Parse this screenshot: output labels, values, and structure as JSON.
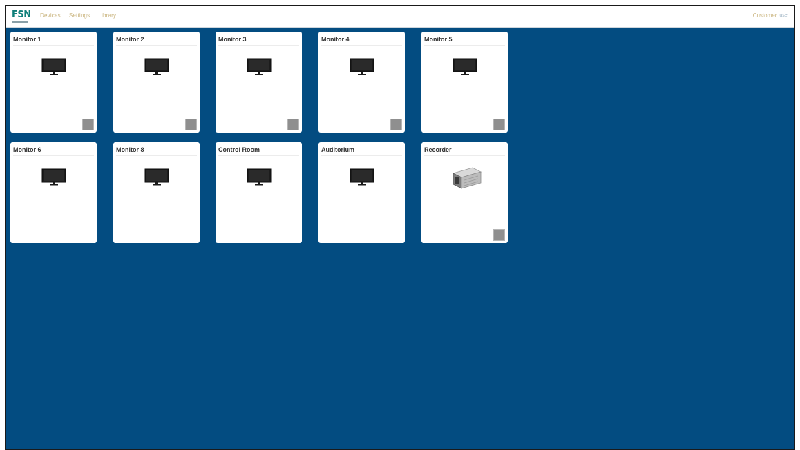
{
  "header": {
    "logo_text": "FSN",
    "nav": [
      {
        "label": "Devices"
      },
      {
        "label": "Settings"
      },
      {
        "label": "Library"
      }
    ],
    "user": {
      "name": "Customer",
      "dropdown": "user"
    }
  },
  "colors": {
    "background": "#034c81",
    "card": "#ffffff",
    "status_square": "#8f8f8f",
    "nav_link": "#c8b27a",
    "logo": "#0f7f7a"
  },
  "devices": [
    {
      "title": "Monitor 1",
      "icon": "monitor-icon",
      "has_status": true
    },
    {
      "title": "Monitor 2",
      "icon": "monitor-icon",
      "has_status": true
    },
    {
      "title": "Monitor 3",
      "icon": "monitor-icon",
      "has_status": true
    },
    {
      "title": "Monitor 4",
      "icon": "monitor-icon",
      "has_status": true
    },
    {
      "title": "Monitor 5",
      "icon": "monitor-icon",
      "has_status": true
    },
    {
      "title": "Monitor 6",
      "icon": "monitor-icon",
      "has_status": false
    },
    {
      "title": "Monitor 8",
      "icon": "monitor-icon",
      "has_status": false
    },
    {
      "title": "Control Room",
      "icon": "monitor-icon",
      "has_status": false
    },
    {
      "title": "Auditorium",
      "icon": "monitor-icon",
      "has_status": false
    },
    {
      "title": "Recorder",
      "icon": "recorder-icon",
      "has_status": true
    }
  ]
}
